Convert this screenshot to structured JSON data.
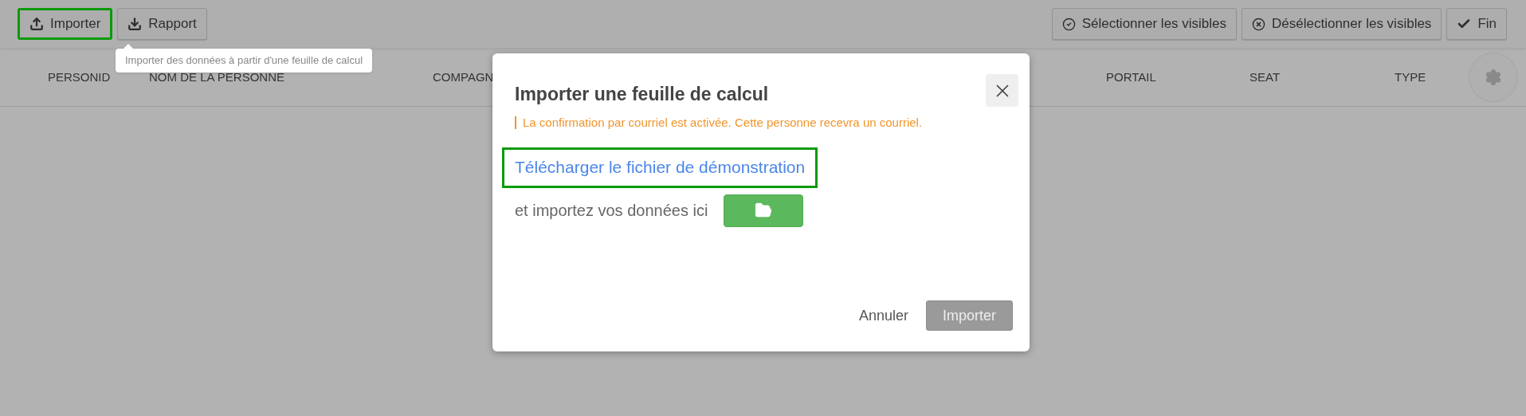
{
  "toolbar": {
    "left_buttons": [
      {
        "label": "Importer",
        "kind": "upload",
        "highlighted": true
      },
      {
        "label": "Rapport",
        "kind": "download",
        "highlighted": false
      }
    ],
    "right_buttons": [
      {
        "label": "Sélectionner les visibles",
        "kind": "select"
      },
      {
        "label": "Désélectionner les visibles",
        "kind": "deselect"
      },
      {
        "label": "Fin",
        "kind": "done"
      }
    ]
  },
  "tooltip": "Importer des données à partir d'une feuille de calcul",
  "table": {
    "columns": [
      "PERSONID",
      "NOM DE LA PERSONNE",
      "COMPAGN",
      "PORTAIL",
      "SEAT",
      "TYPE"
    ]
  },
  "dialog": {
    "title": "Importer une feuille de calcul",
    "notice": "La confirmation par courriel est activée. Cette personne recevra un courriel.",
    "download_link": {
      "label": "Télécharger le fichier de démonstration",
      "highlighted": true
    },
    "import_prompt": "et importez vos données ici",
    "cancel": "Annuler",
    "submit": {
      "label": "Importer",
      "disabled": true
    }
  }
}
